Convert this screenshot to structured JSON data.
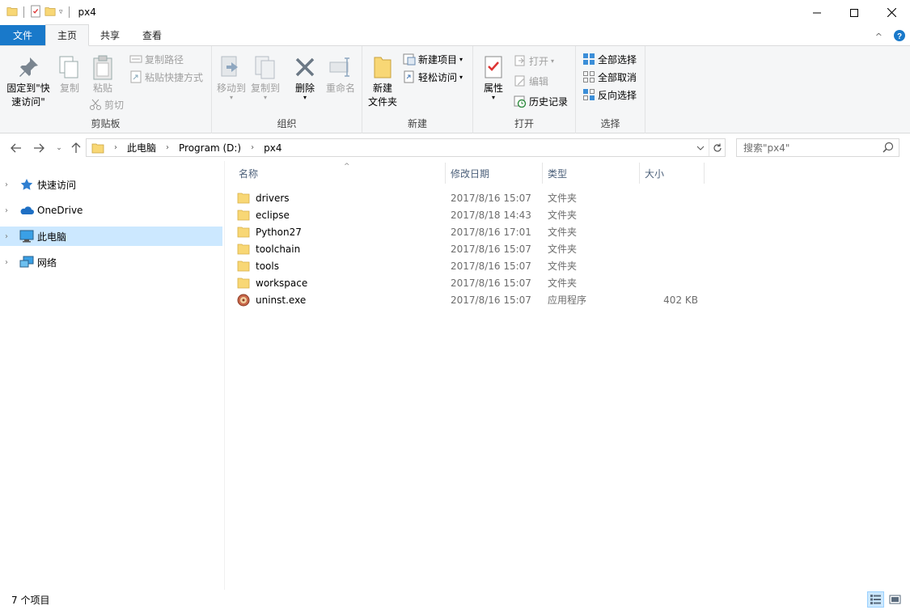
{
  "window": {
    "title": "px4",
    "minimize_glyph": "—",
    "maximize_glyph": "☐",
    "close_glyph": "✕"
  },
  "ribbon_tabs": {
    "file": "文件",
    "home": "主页",
    "share": "共享",
    "view": "查看"
  },
  "ribbon": {
    "clipboard": {
      "label": "剪贴板",
      "pin": "固定到\"快速访问\"",
      "copy": "复制",
      "paste": "粘贴",
      "copy_path": "复制路径",
      "paste_shortcut": "粘贴快捷方式",
      "cut": "剪切"
    },
    "organize": {
      "label": "组织",
      "move_to": "移动到",
      "copy_to": "复制到",
      "delete": "删除",
      "rename": "重命名"
    },
    "new": {
      "label": "新建",
      "new_folder": "新建\n文件夹",
      "new_item": "新建项目",
      "easy_access": "轻松访问"
    },
    "open": {
      "label": "打开",
      "properties": "属性",
      "open": "打开",
      "edit": "编辑",
      "history": "历史记录"
    },
    "select": {
      "label": "选择",
      "select_all": "全部选择",
      "select_none": "全部取消",
      "invert": "反向选择"
    }
  },
  "address": {
    "crumbs": [
      "此电脑",
      "Program (D:)",
      "px4"
    ]
  },
  "search": {
    "placeholder": "搜索\"px4\""
  },
  "nav_pane": {
    "items": [
      {
        "label": "快速访问",
        "icon": "star-icon"
      },
      {
        "label": "OneDrive",
        "icon": "cloud-icon"
      },
      {
        "label": "此电脑",
        "icon": "pc-icon"
      },
      {
        "label": "网络",
        "icon": "network-icon"
      }
    ]
  },
  "file_list": {
    "columns": {
      "name": "名称",
      "date": "修改日期",
      "type": "类型",
      "size": "大小"
    },
    "rows": [
      {
        "name": "drivers",
        "date": "2017/8/16 15:07",
        "type": "文件夹",
        "size": "",
        "icon": "folder-icon"
      },
      {
        "name": "eclipse",
        "date": "2017/8/18 14:43",
        "type": "文件夹",
        "size": "",
        "icon": "folder-icon"
      },
      {
        "name": "Python27",
        "date": "2017/8/16 17:01",
        "type": "文件夹",
        "size": "",
        "icon": "folder-icon"
      },
      {
        "name": "toolchain",
        "date": "2017/8/16 15:07",
        "type": "文件夹",
        "size": "",
        "icon": "folder-icon"
      },
      {
        "name": "tools",
        "date": "2017/8/16 15:07",
        "type": "文件夹",
        "size": "",
        "icon": "folder-icon"
      },
      {
        "name": "workspace",
        "date": "2017/8/16 15:07",
        "type": "文件夹",
        "size": "",
        "icon": "folder-icon"
      },
      {
        "name": "uninst.exe",
        "date": "2017/8/16 15:07",
        "type": "应用程序",
        "size": "402 KB",
        "icon": "exe-icon"
      }
    ]
  },
  "status_bar": {
    "item_count": "7 个项目"
  },
  "colors": {
    "accent": "#1979ca",
    "selection": "#cce8ff",
    "folder": "#f8d775",
    "ribbon_bg": "#f5f6f7"
  }
}
